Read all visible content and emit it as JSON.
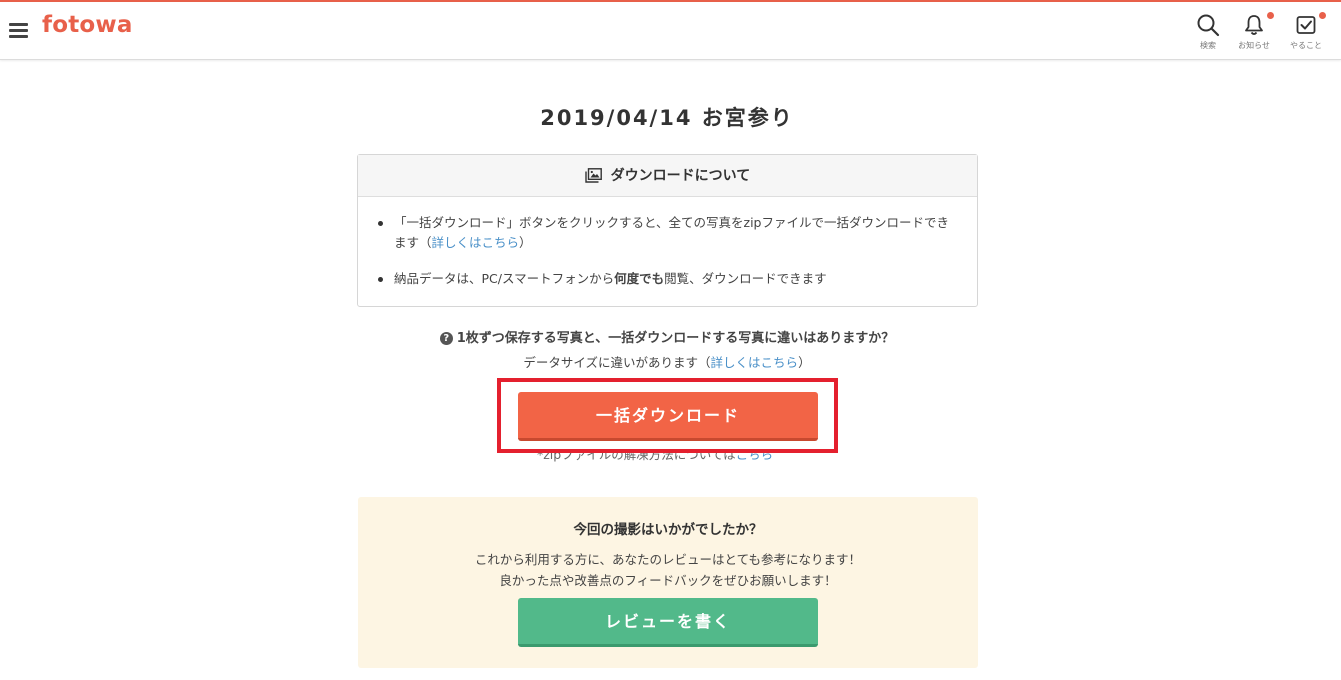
{
  "header": {
    "logo": "fotowa",
    "icons": [
      {
        "name": "search-icon",
        "label": "検索"
      },
      {
        "name": "bell-icon",
        "label": "お知らせ"
      },
      {
        "name": "checkbox-icon",
        "label": "やること"
      }
    ],
    "accent_color": "#e8604a"
  },
  "page": {
    "title": "2019/04/14 お宮参り"
  },
  "info_box": {
    "heading": "ダウンロードについて",
    "item1_text": "「一括ダウンロード」ボタンをクリックすると、全ての写真をzipファイルで一括ダウンロードできます（",
    "item1_link": "詳しくはこちら",
    "item1_suffix": "）",
    "item2_pre": "納品データは、PC/スマートフォンから",
    "item2_bold": "何度でも",
    "item2_post": "閲覧、ダウンロードできます"
  },
  "faq": {
    "question": "1枚ずつ保存する写真と、一括ダウンロードする写真に違いはありますか？",
    "answer_pre": "データサイズに違いがあります（",
    "answer_link": "詳しくはこちら",
    "answer_post": "）"
  },
  "download": {
    "button_label": "一括ダウンロード",
    "zip_note_pre": "*zipファイルの解凍方法については",
    "zip_note_link": "こちら",
    "button_color": "#f26446",
    "highlight_color": "#e4202e"
  },
  "review": {
    "title": "今回の撮影はいかがでしたか？",
    "line1": "これから利用する方に、あなたのレビューはとても参考になります！",
    "line2": "良かった点や改善点のフィードバックをぜひお願いします！",
    "button_label": "レビューを書く",
    "button_color": "#52b98a"
  }
}
